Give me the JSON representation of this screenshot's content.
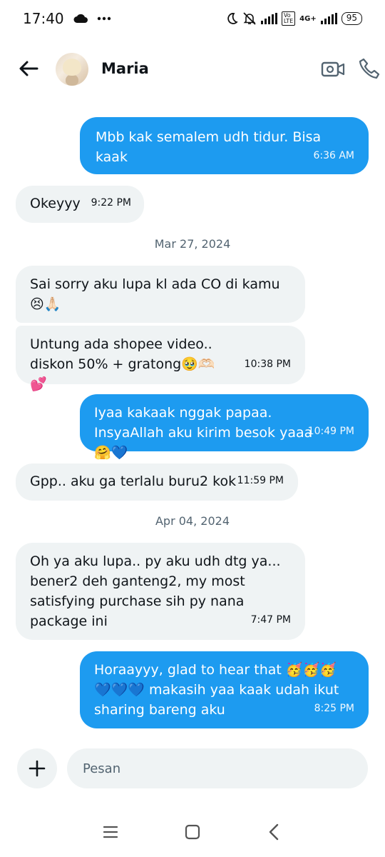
{
  "status_bar": {
    "time": "17:40",
    "network": "4G+",
    "battery": "95",
    "icons": [
      "cloud-icon",
      "more-dots-icon",
      "moon-icon",
      "bell-off-icon",
      "signal-icon",
      "volte-icon",
      "signal-icon",
      "battery-icon"
    ]
  },
  "header": {
    "contact_name": "Maria",
    "icons": [
      "back-arrow-icon",
      "video-call-icon",
      "phone-icon"
    ]
  },
  "messages": [
    {
      "direction": "outgoing",
      "text": "Mbb kak semalem udh tidur. Bisa kaak",
      "time": "6:36 AM"
    },
    {
      "direction": "incoming",
      "text": "Okeyyy",
      "time": "9:22 PM"
    },
    {
      "type": "date",
      "text": "Mar 27, 2024"
    },
    {
      "direction": "incoming",
      "text": "Sai sorry aku lupa kl ada CO di kamu 😣🙏🏻",
      "time": ""
    },
    {
      "direction": "incoming",
      "text": "Untung ada shopee video.. diskon 50% + gratong🥹🫶🏻💕",
      "time": "10:38 PM"
    },
    {
      "direction": "outgoing",
      "text": "Iyaa kakaak nggak papaa. InsyaAllah aku kirim besok yaaa 🤗💙",
      "time": "10:49 PM"
    },
    {
      "direction": "incoming",
      "text": "Gpp.. aku ga terlalu buru2 kok",
      "time": "11:59 PM"
    },
    {
      "type": "date",
      "text": "Apr 04, 2024"
    },
    {
      "direction": "incoming",
      "text": "Oh ya aku lupa.. py aku udh dtg ya... bener2 deh ganteng2, my most satisfying purchase sih py nana package ini",
      "time": "7:47 PM"
    },
    {
      "direction": "outgoing",
      "text": "Horaayyy, glad to hear that 🥳🥳🥳 💙💙💙 makasih yaa kaak udah ikut sharing bareng aku",
      "time": "8:25 PM"
    }
  ],
  "composer": {
    "placeholder": "Pesan",
    "add_icon": "plus-icon"
  },
  "nav_bar": {
    "icons": [
      "menu-icon",
      "home-square-icon",
      "back-chevron-icon"
    ]
  },
  "colors": {
    "outgoing_bubble": "#1d9bf0",
    "incoming_bubble": "#eff3f4",
    "date_text": "#536471"
  }
}
